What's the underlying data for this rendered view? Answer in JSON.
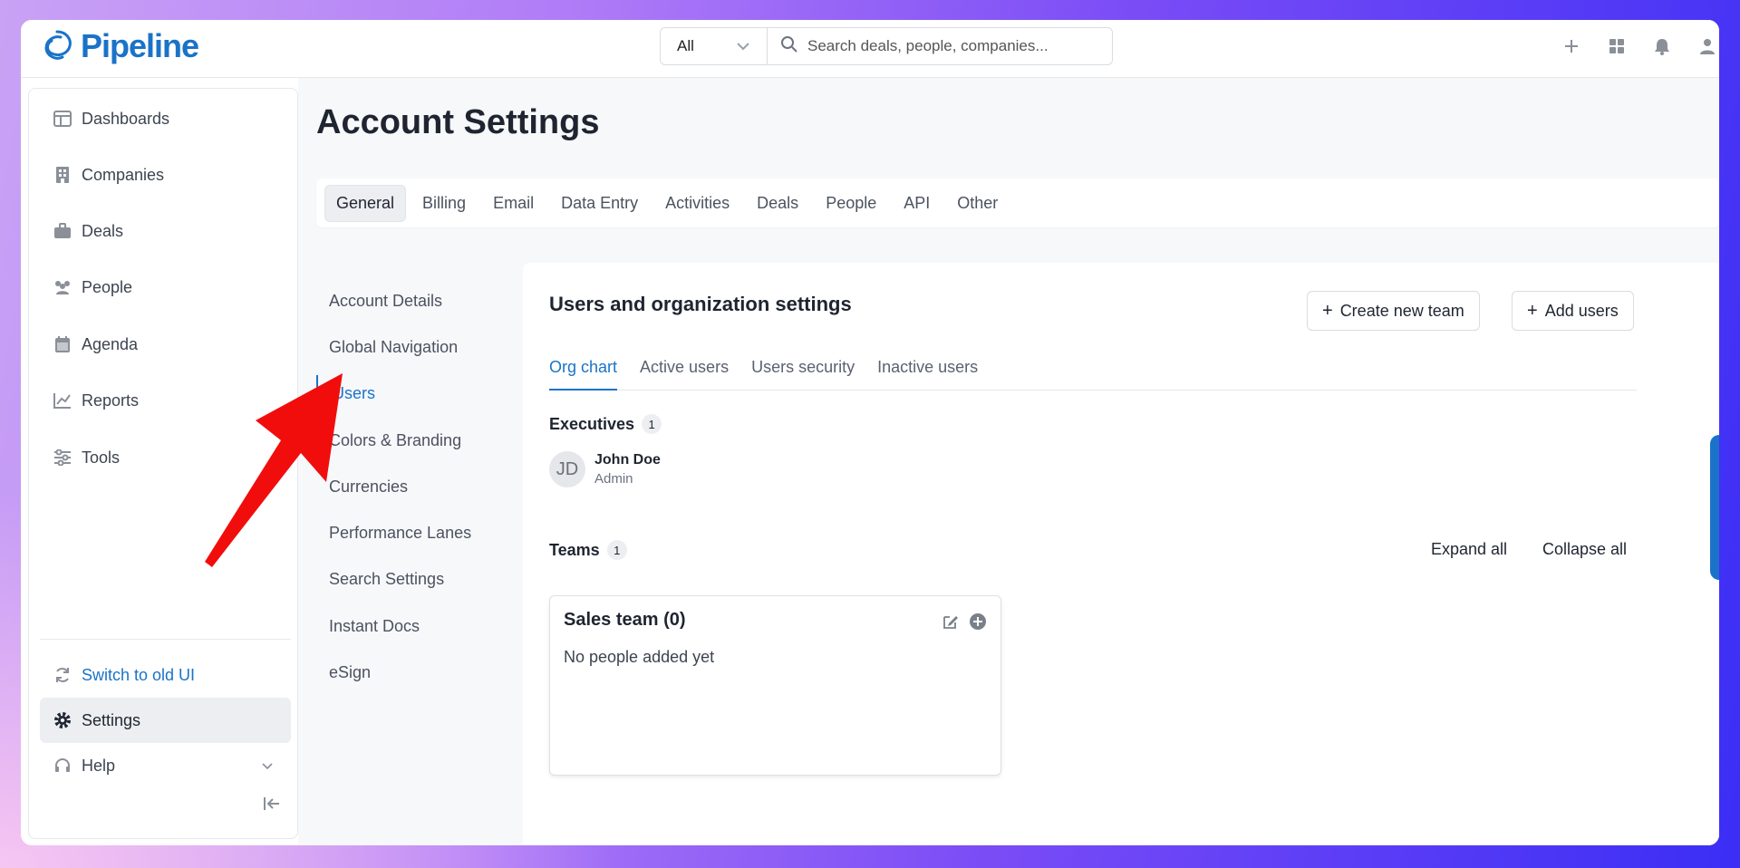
{
  "app": {
    "name": "Pipeline",
    "brand_color": "#1a73c8"
  },
  "topbar": {
    "scope_value": "All",
    "search_placeholder": "Search deals, people, companies...",
    "icons": [
      "plus-icon",
      "apps-grid-icon",
      "bell-icon",
      "user-icon"
    ]
  },
  "sidebar": {
    "items": [
      {
        "label": "Dashboards",
        "icon": "dashboard-icon"
      },
      {
        "label": "Companies",
        "icon": "building-icon"
      },
      {
        "label": "Deals",
        "icon": "briefcase-icon"
      },
      {
        "label": "People",
        "icon": "people-icon"
      },
      {
        "label": "Agenda",
        "icon": "calendar-icon"
      },
      {
        "label": "Reports",
        "icon": "chart-line-icon"
      },
      {
        "label": "Tools",
        "icon": "sliders-icon"
      }
    ],
    "bottom": {
      "switch_ui": "Switch to old UI",
      "settings": "Settings",
      "help": "Help"
    }
  },
  "page": {
    "title": "Account Settings",
    "tabs": [
      "General",
      "Billing",
      "Email",
      "Data Entry",
      "Activities",
      "Deals",
      "People",
      "API",
      "Other"
    ],
    "active_tab": "General",
    "sub_nav": [
      "Account Details",
      "Global Navigation",
      "Users",
      "Colors & Branding",
      "Currencies",
      "Performance Lanes",
      "Search Settings",
      "Instant Docs",
      "eSign"
    ],
    "active_sub": "Users"
  },
  "panel": {
    "title": "Users and organization settings",
    "create_team_label": "Create new team",
    "add_users_label": "Add users",
    "tabs": [
      "Org chart",
      "Active users",
      "Users security",
      "Inactive users"
    ],
    "active_tab": "Org chart",
    "executives": {
      "label": "Executives",
      "count": "1",
      "person": {
        "initials": "JD",
        "name": "John Doe",
        "role": "Admin"
      }
    },
    "teams": {
      "label": "Teams",
      "count": "1",
      "expand_all": "Expand all",
      "collapse_all": "Collapse all",
      "card": {
        "title": "Sales team (0)",
        "empty": "No people added yet"
      }
    }
  },
  "annotation": {
    "arrow_color": "#f20d0d"
  }
}
